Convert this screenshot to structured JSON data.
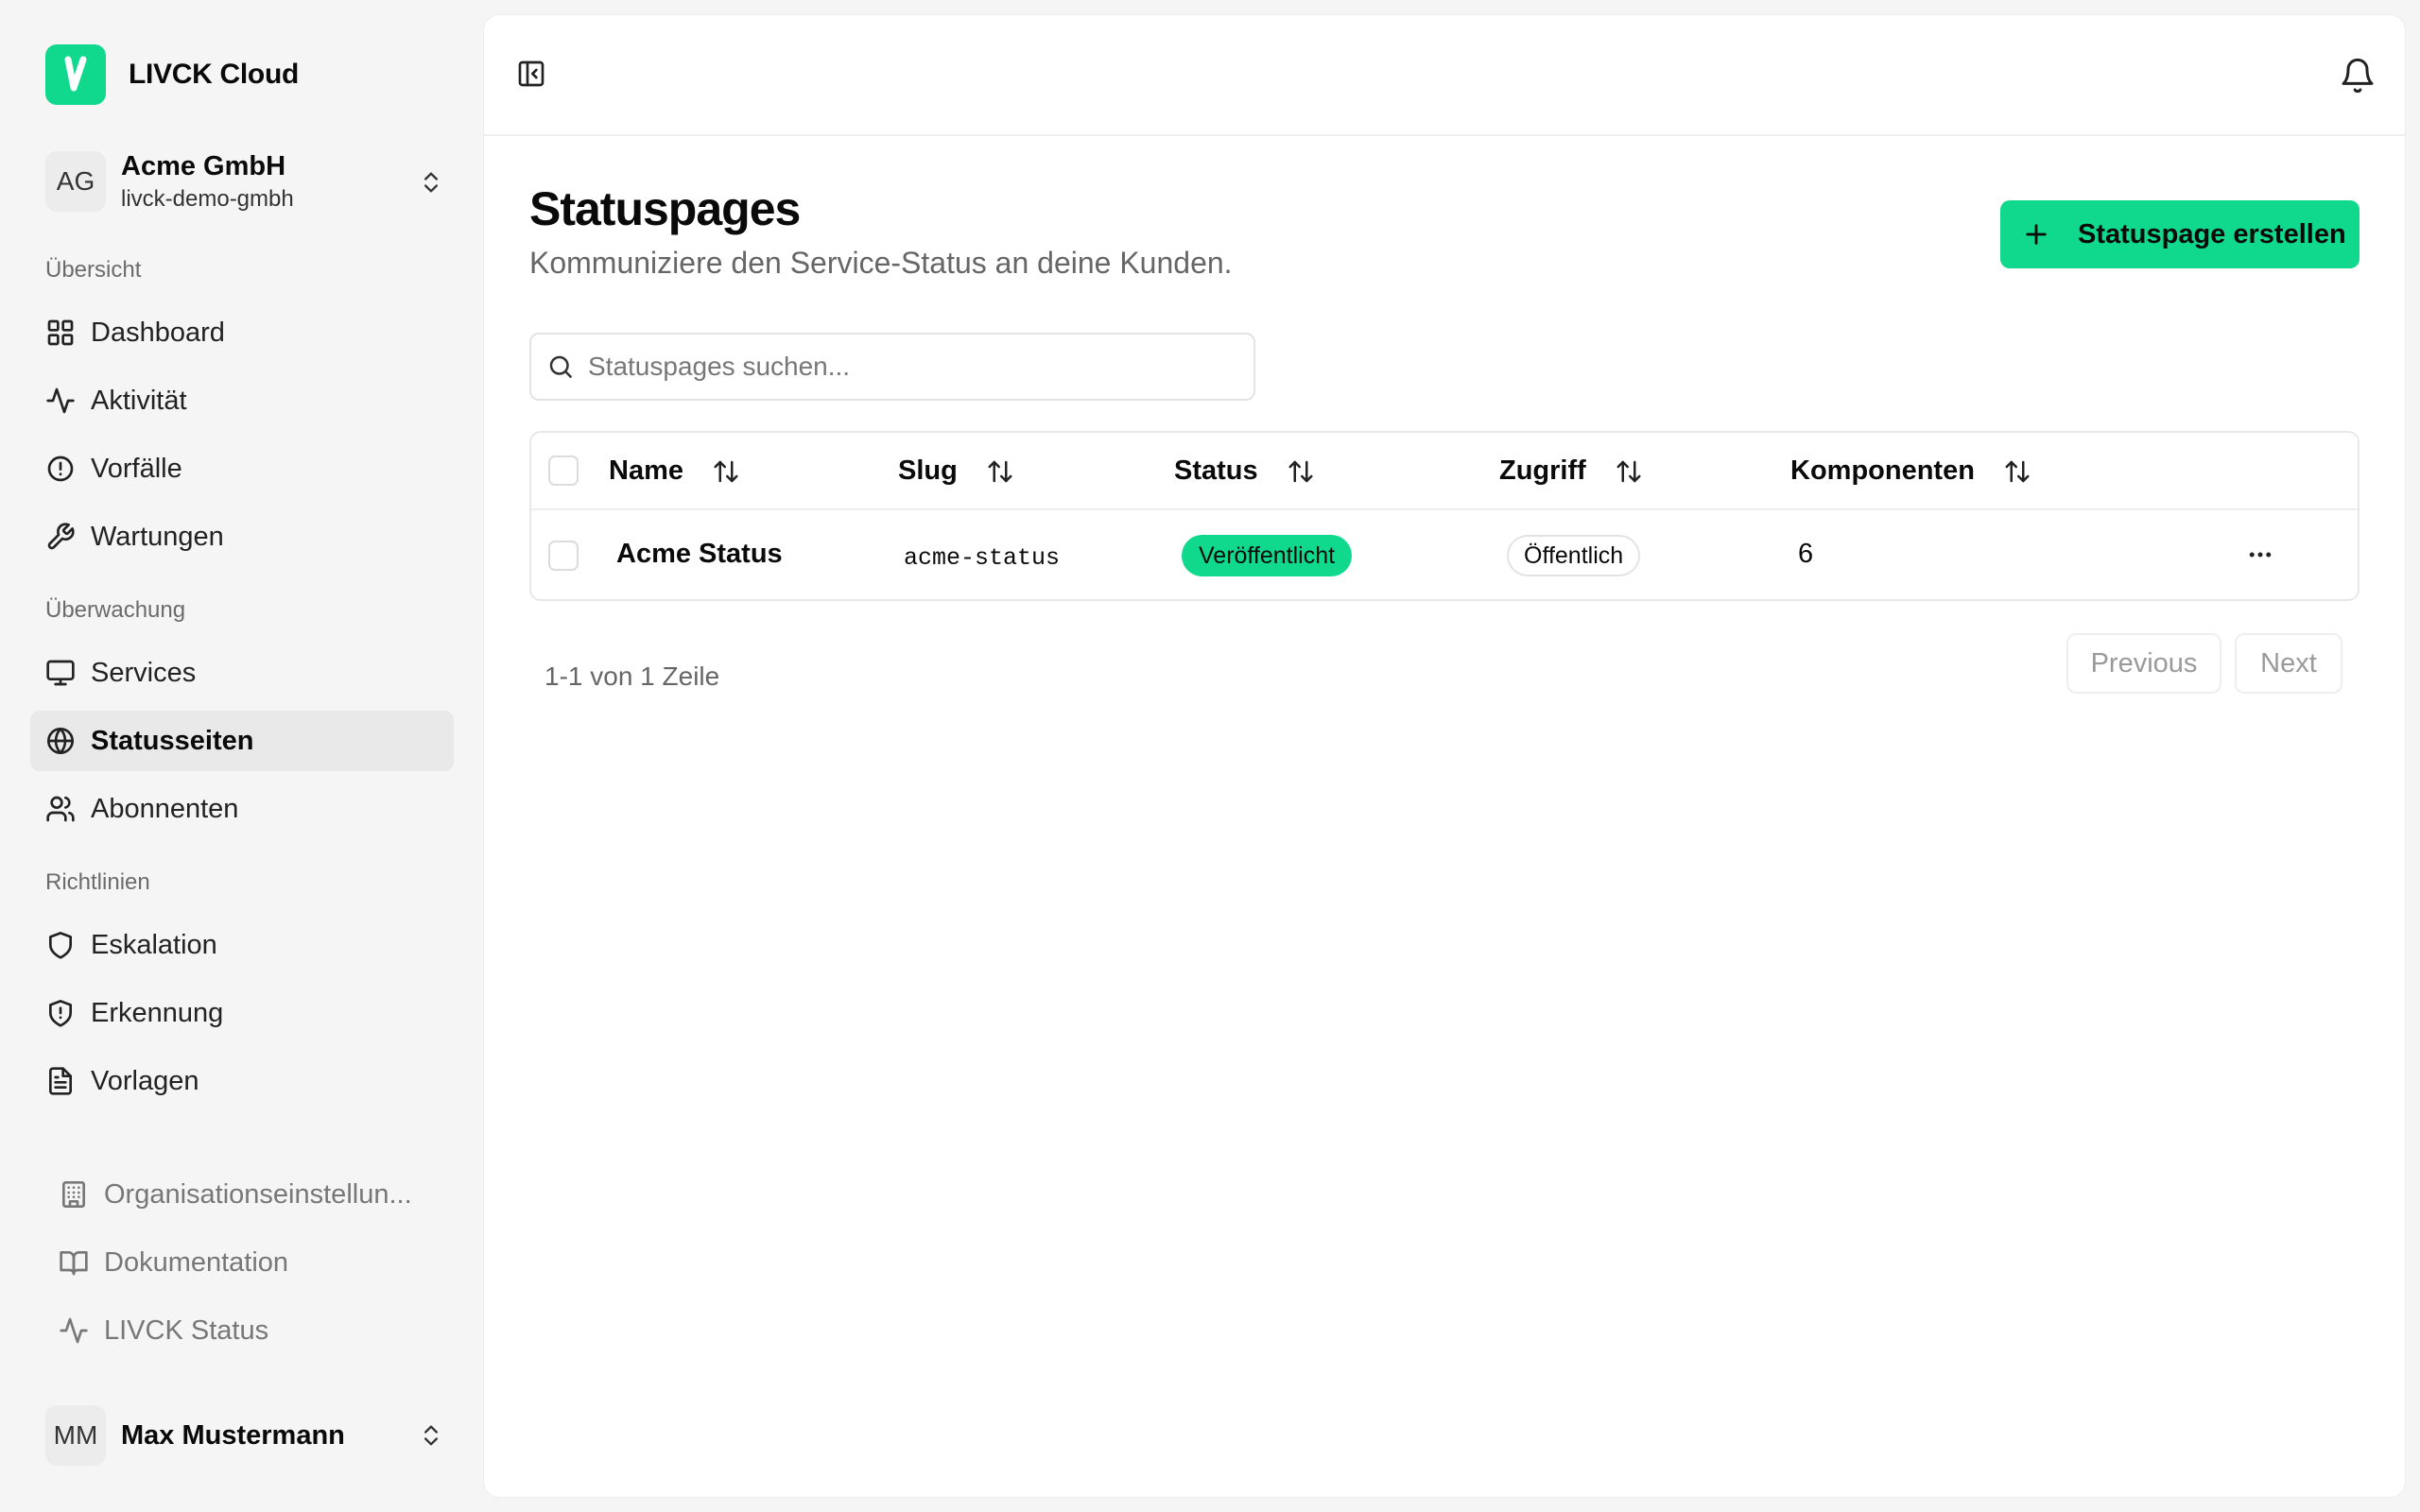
{
  "app": {
    "name": "LIVCK Cloud"
  },
  "org": {
    "initials": "AG",
    "name": "Acme GmbH",
    "slug": "livck-demo-gmbh"
  },
  "sidebar": {
    "sections": [
      {
        "label": "Übersicht"
      },
      {
        "label": "Überwachung"
      },
      {
        "label": "Richtlinien"
      }
    ],
    "items": [
      {
        "label": "Dashboard",
        "icon": "dashboard-icon"
      },
      {
        "label": "Aktivität",
        "icon": "activity-icon"
      },
      {
        "label": "Vorfälle",
        "icon": "alert-circle-icon"
      },
      {
        "label": "Wartungen",
        "icon": "wrench-icon"
      },
      {
        "label": "Services",
        "icon": "monitor-icon"
      },
      {
        "label": "Statusseiten",
        "icon": "globe-icon",
        "active": true
      },
      {
        "label": "Abonnenten",
        "icon": "users-icon"
      },
      {
        "label": "Eskalation",
        "icon": "shield-icon"
      },
      {
        "label": "Erkennung",
        "icon": "shield-alert-icon"
      },
      {
        "label": "Vorlagen",
        "icon": "file-icon"
      }
    ],
    "bottom": [
      {
        "label": "Organisationseinstellun...",
        "icon": "building-icon"
      },
      {
        "label": "Dokumentation",
        "icon": "book-icon"
      },
      {
        "label": "LIVCK Status",
        "icon": "activity-icon"
      }
    ]
  },
  "user": {
    "initials": "MM",
    "name": "Max Mustermann"
  },
  "page": {
    "title": "Statuspages",
    "subtitle": "Kommuniziere den Service-Status an deine Kunden.",
    "create_label": "Statuspage erstellen"
  },
  "search": {
    "placeholder": "Statuspages suchen...",
    "value": ""
  },
  "table": {
    "columns": [
      "Name",
      "Slug",
      "Status",
      "Zugriff",
      "Komponenten"
    ],
    "rows": [
      {
        "name": "Acme Status",
        "slug": "acme-status",
        "status": "Veröffentlicht",
        "access": "Öffentlich",
        "components": "6"
      }
    ]
  },
  "pagination": {
    "summary": "1-1 von 1 Zeile",
    "previous": "Previous",
    "next": "Next"
  },
  "colors": {
    "accent": "#10d98d",
    "active_bg": "#e9e9e9",
    "page_bg": "#f5f5f5"
  }
}
